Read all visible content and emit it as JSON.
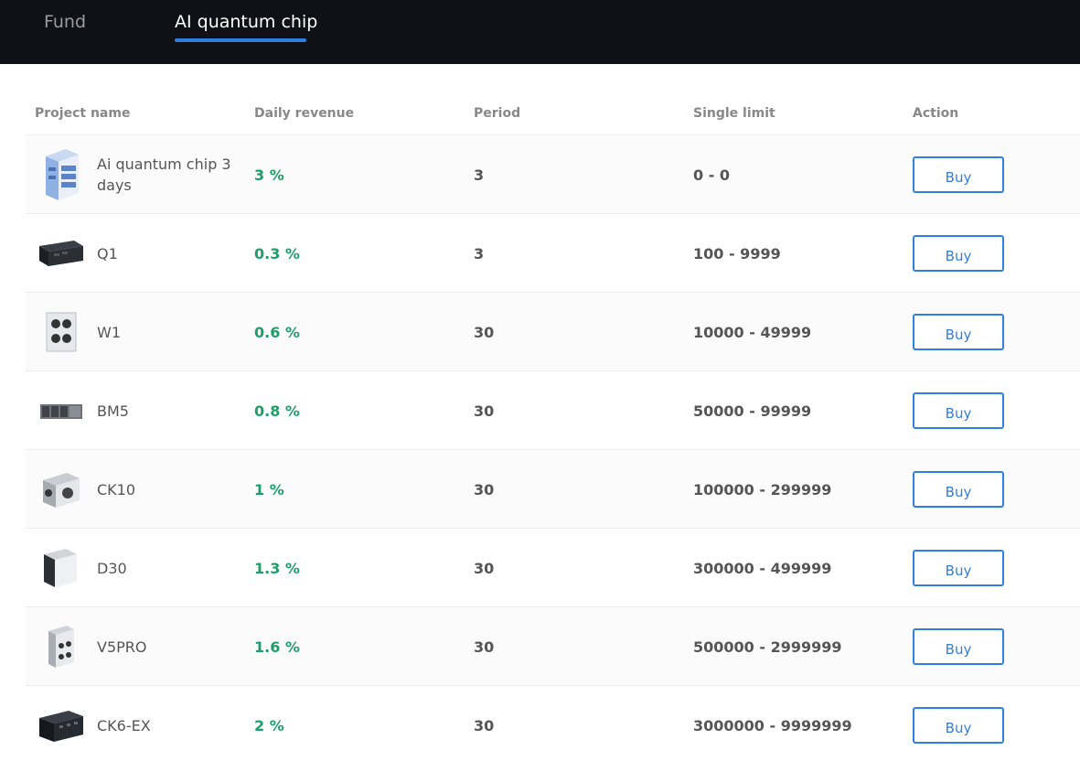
{
  "tabs": [
    {
      "label": "Fund",
      "active": false
    },
    {
      "label": "AI quantum chip",
      "active": true
    }
  ],
  "table": {
    "headers": [
      "Project name",
      "Daily revenue",
      "Period",
      "Single limit",
      "Action"
    ],
    "rows": [
      {
        "name": "Ai quantum chip 3 days",
        "revenue": "3 %",
        "period": "3",
        "limit": "0 - 0",
        "action": "Buy",
        "icon": "server-rack-icon"
      },
      {
        "name": "Q1",
        "revenue": "0.3 %",
        "period": "3",
        "limit": "100 - 9999",
        "action": "Buy",
        "icon": "miner-box-icon"
      },
      {
        "name": "W1",
        "revenue": "0.6 %",
        "period": "30",
        "limit": "10000 - 49999",
        "action": "Buy",
        "icon": "asic-miner-icon"
      },
      {
        "name": "BM5",
        "revenue": "0.8 %",
        "period": "30",
        "limit": "50000 - 99999",
        "action": "Buy",
        "icon": "miner-unit-icon"
      },
      {
        "name": "CK10",
        "revenue": "1 %",
        "period": "30",
        "limit": "100000 - 299999",
        "action": "Buy",
        "icon": "asic-miner-icon"
      },
      {
        "name": "D30",
        "revenue": "1.3 %",
        "period": "30",
        "limit": "300000 - 499999",
        "action": "Buy",
        "icon": "asic-miner-icon"
      },
      {
        "name": "V5PRO",
        "revenue": "1.6 %",
        "period": "30",
        "limit": "500000 - 2999999",
        "action": "Buy",
        "icon": "asic-miner-icon"
      },
      {
        "name": "CK6-EX",
        "revenue": "2 %",
        "period": "30",
        "limit": "3000000 - 9999999",
        "action": "Buy",
        "icon": "miner-box-icon"
      }
    ]
  },
  "colors": {
    "topbar_bg": "#101116",
    "accent": "#2f7fe0",
    "revenue_green": "#1f9d6b"
  }
}
